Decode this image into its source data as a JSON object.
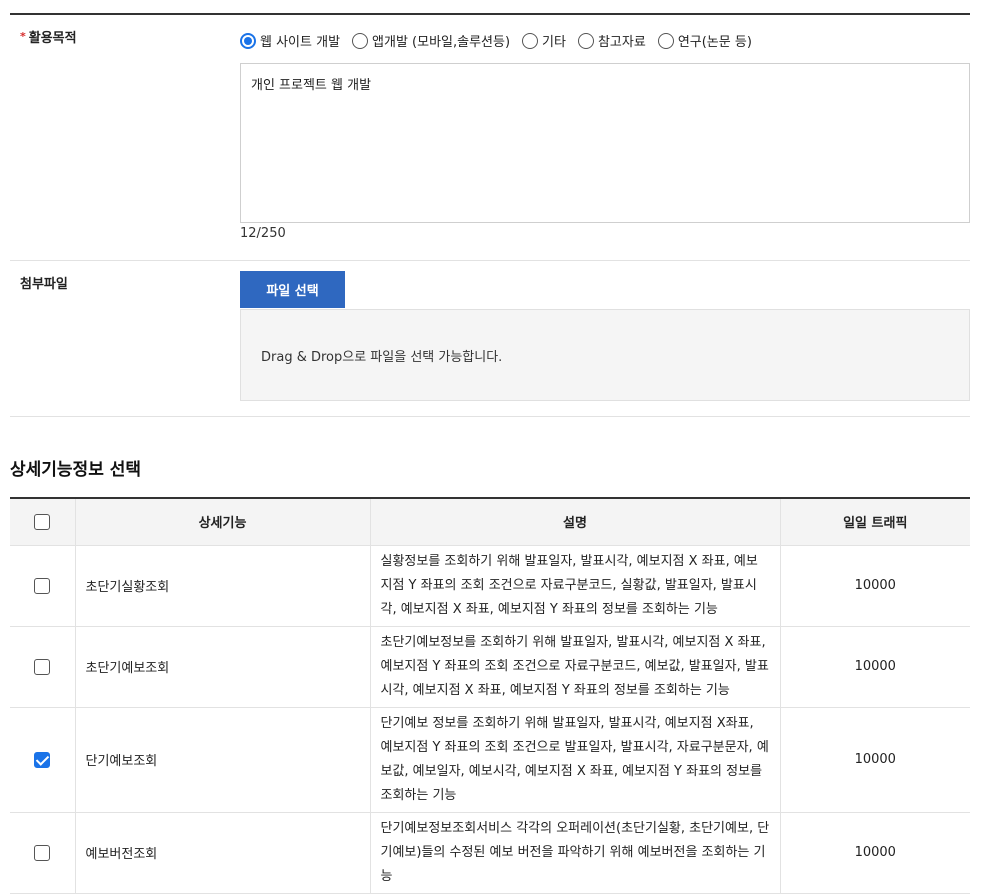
{
  "purpose": {
    "required_mark": "*",
    "label": "활용목적",
    "options": [
      {
        "label": "웹 사이트 개발",
        "selected": true
      },
      {
        "label": "앱개발 (모바일,솔루션등)",
        "selected": false
      },
      {
        "label": "기타",
        "selected": false
      },
      {
        "label": "참고자료",
        "selected": false
      },
      {
        "label": "연구(논문 등)",
        "selected": false
      }
    ],
    "text_value": "개인 프로젝트 웹 개발",
    "counter": "12/250"
  },
  "attachment": {
    "label": "첨부파일",
    "button_label": "파일 선택",
    "dropzone_text": "Drag & Drop으로 파일을 선택 가능합니다."
  },
  "detail": {
    "title": "상세기능정보 선택",
    "headers": {
      "name": "상세기능",
      "description": "설명",
      "traffic": "일일 트래픽"
    },
    "header_checked": false,
    "rows": [
      {
        "checked": false,
        "name": "초단기실황조회",
        "description": "실황정보를 조회하기 위해 발표일자, 발표시각, 예보지점 X 좌표, 예보지점 Y 좌표의 조회 조건으로 자료구분코드, 실황값, 발표일자, 발표시각, 예보지점 X 좌표, 예보지점 Y 좌표의 정보를 조회하는 기능",
        "traffic": "10000"
      },
      {
        "checked": false,
        "name": "초단기예보조회",
        "description": "초단기예보정보를 조회하기 위해 발표일자, 발표시각, 예보지점 X 좌표, 예보지점 Y 좌표의 조회 조건으로 자료구분코드, 예보값, 발표일자, 발표시각, 예보지점 X 좌표, 예보지점 Y 좌표의 정보를 조회하는 기능",
        "traffic": "10000"
      },
      {
        "checked": true,
        "name": "단기예보조회",
        "description": "단기예보 정보를 조회하기 위해 발표일자, 발표시각, 예보지점 X좌표, 예보지점 Y 좌표의 조회 조건으로 발표일자, 발표시각, 자료구분문자, 예보값, 예보일자, 예보시각, 예보지점 X 좌표, 예보지점 Y 좌표의 정보를 조회하는 기능",
        "traffic": "10000"
      },
      {
        "checked": false,
        "name": "예보버전조회",
        "description": "단기예보정보조회서비스 각각의 오퍼레이션(초단기실황, 초단기예보, 단기예보)들의 수정된 예보 버전을 파악하기 위해 예보버전을 조회하는 기능",
        "traffic": "10000"
      }
    ]
  },
  "colors": {
    "accent": "#1a73e8",
    "button": "#2f68c0",
    "required": "#d62c2c"
  }
}
